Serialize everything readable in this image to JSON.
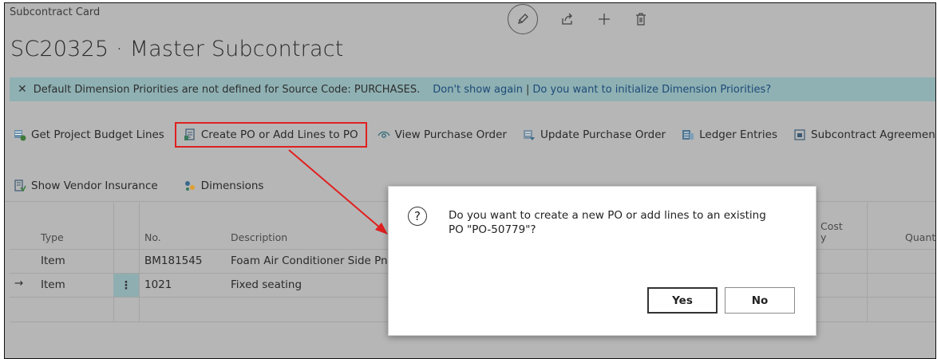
{
  "page": {
    "breadcrumb": "Subcontract Card",
    "title": "SC20325 · Master Subcontract"
  },
  "header_actions": [
    "edit-icon",
    "share-icon",
    "add-icon",
    "delete-icon"
  ],
  "notification": {
    "message": "Default Dimension Priorities are not defined for Source Code: PURCHASES.",
    "dont_show": "Don't show again",
    "separator": "|",
    "initialize": "Do you want to initialize Dimension Priorities?"
  },
  "toolbar": {
    "get_project_budget_lines": "Get Project Budget Lines",
    "create_po": "Create PO or Add Lines to PO",
    "view_purchase_order": "View Purchase Order",
    "update_purchase_order": "Update Purchase Order",
    "ledger_entries": "Ledger Entries",
    "subcontract_agreement": "Subcontract Agreemen"
  },
  "toolbar2": {
    "show_vendor_insurance": "Show Vendor Insurance",
    "dimensions": "Dimensions"
  },
  "grid": {
    "columns": {
      "type": "Type",
      "no": "No.",
      "description": "Description",
      "cost_top": "Cost",
      "cost_bottom": "y",
      "quantity": "Quant"
    },
    "rows": [
      {
        "type": "Item",
        "no": "BM181545",
        "description": "Foam Air Conditioner Side Pnl",
        "active": false
      },
      {
        "type": "Item",
        "no": "1021",
        "description": "Fixed seating",
        "active": true
      }
    ],
    "row_menu": "⋮",
    "row_arrow": "→"
  },
  "dialog": {
    "icon": "?",
    "message": "Do you want to create a new PO or add lines to an existing PO \"PO-50779\"?",
    "yes": "Yes",
    "no": "No"
  },
  "colors": {
    "highlight": "#e02020",
    "notification_bg": "#8fb1b3",
    "link": "#1d4a78"
  }
}
